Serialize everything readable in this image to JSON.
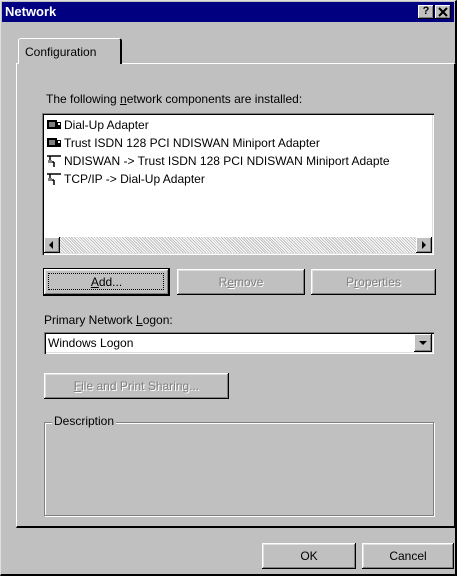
{
  "window": {
    "title": "Network",
    "help_label": "?",
    "close_label": "X"
  },
  "tabs": [
    {
      "label": "Configuration"
    }
  ],
  "components": {
    "caption_pre": "The following ",
    "caption_mnemonic": "n",
    "caption_post": "etwork components are installed:",
    "items": [
      {
        "label": "Dial-Up Adapter",
        "icon": "network-adapter-icon"
      },
      {
        "label": "Trust ISDN 128 PCI NDISWAN Miniport Adapter",
        "icon": "network-adapter-icon"
      },
      {
        "label": "NDISWAN -> Trust ISDN 128 PCI NDISWAN Miniport Adapte",
        "icon": "protocol-icon"
      },
      {
        "label": "TCP/IP -> Dial-Up Adapter",
        "icon": "protocol-icon"
      }
    ]
  },
  "buttons": {
    "add_mn": "A",
    "add_rest": "dd...",
    "remove_pre": "R",
    "remove_mn": "e",
    "remove_rest": "move",
    "properties_pre": "P",
    "properties_mn": "r",
    "properties_rest": "operties",
    "file_print_mn": "F",
    "file_print_rest": "ile and Print Sharing...",
    "ok": "OK",
    "cancel": "Cancel"
  },
  "logon": {
    "label_pre": "Primary Network ",
    "label_mn": "L",
    "label_post": "ogon:",
    "value": "Windows Logon"
  },
  "description": {
    "label": "Description"
  }
}
